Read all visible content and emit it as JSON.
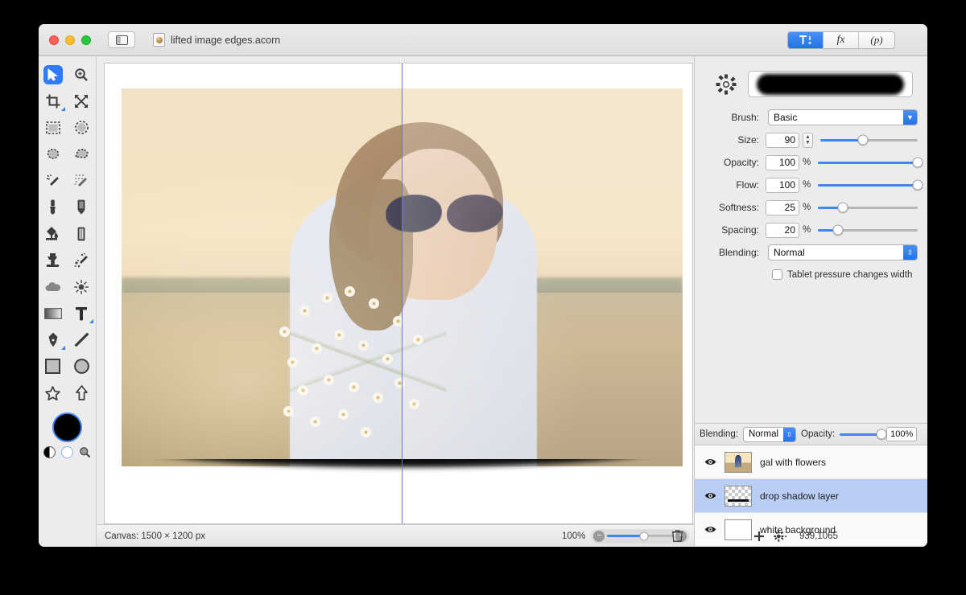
{
  "window": {
    "title": "lifted image edges.acorn",
    "traffic_lights": [
      "close",
      "minimize",
      "zoom"
    ],
    "sidebar_toggle": "sidebar-toggle"
  },
  "inspector_tabs": [
    {
      "id": "tool",
      "label": "",
      "icon": "tool-options-icon",
      "selected": true
    },
    {
      "id": "fx",
      "label": "fx",
      "icon": "effects-icon",
      "selected": false
    },
    {
      "id": "p",
      "label": "(p)",
      "icon": "presets-icon",
      "selected": false
    }
  ],
  "tools": [
    {
      "name": "move-tool",
      "icon": "arrow-cursor-icon",
      "selected": true
    },
    {
      "name": "zoom-tool",
      "icon": "magnifier-plus-icon",
      "selected": false
    },
    {
      "name": "crop-tool",
      "icon": "crop-icon",
      "selected": false,
      "badge": true
    },
    {
      "name": "transform-tool",
      "icon": "transform-arrows-icon",
      "selected": false
    },
    {
      "name": "rectangular-select-tool",
      "icon": "rect-marquee-icon",
      "selected": false
    },
    {
      "name": "elliptical-select-tool",
      "icon": "ellipse-marquee-icon",
      "selected": false
    },
    {
      "name": "lasso-tool",
      "icon": "lasso-icon",
      "selected": false
    },
    {
      "name": "polygon-lasso-tool",
      "icon": "polygon-lasso-icon",
      "selected": false
    },
    {
      "name": "magic-wand-tool",
      "icon": "magic-wand-icon",
      "selected": false
    },
    {
      "name": "instant-alpha-tool",
      "icon": "magic-wand-dotted-icon",
      "selected": false
    },
    {
      "name": "brush-tool",
      "icon": "paintbrush-icon",
      "selected": false
    },
    {
      "name": "pencil-tool",
      "icon": "pencil-icon",
      "selected": false
    },
    {
      "name": "paint-bucket-tool",
      "icon": "paint-bucket-icon",
      "selected": false
    },
    {
      "name": "eraser-tool",
      "icon": "eraser-icon",
      "selected": false
    },
    {
      "name": "clone-stamp-tool",
      "icon": "clone-stamp-icon",
      "selected": false
    },
    {
      "name": "smudge-tool",
      "icon": "smudge-icon",
      "selected": false
    },
    {
      "name": "blur-tool",
      "icon": "cloud-blur-icon",
      "selected": false
    },
    {
      "name": "dodge-tool",
      "icon": "dodge-sun-icon",
      "selected": false
    },
    {
      "name": "gradient-tool",
      "icon": "gradient-icon",
      "selected": false
    },
    {
      "name": "text-tool",
      "icon": "text-t-icon",
      "selected": false,
      "badge": true
    },
    {
      "name": "bezier-pen-tool",
      "icon": "pen-nib-icon",
      "selected": false,
      "badge": true
    },
    {
      "name": "line-tool",
      "icon": "line-icon",
      "selected": false
    },
    {
      "name": "rectangle-tool",
      "icon": "rectangle-shape-icon",
      "selected": false
    },
    {
      "name": "ellipse-tool",
      "icon": "ellipse-shape-icon",
      "selected": false
    },
    {
      "name": "star-tool",
      "icon": "star-shape-icon",
      "selected": false
    },
    {
      "name": "arrow-tool",
      "icon": "arrow-shape-icon",
      "selected": false
    }
  ],
  "colors": {
    "foreground": "#000000",
    "background": "#ffffff",
    "accent": "#2f7bf6",
    "selection_row": "#b9cdf5"
  },
  "brush_panel": {
    "preview_label": "brush-preview",
    "gear_label": "brush-settings-gear",
    "brush": {
      "label": "Brush:",
      "value": "Basic"
    },
    "size": {
      "label": "Size:",
      "value": "90",
      "unit": "",
      "fill_pct": 44
    },
    "opacity": {
      "label": "Opacity:",
      "value": "100",
      "unit": "%",
      "fill_pct": 100
    },
    "flow": {
      "label": "Flow:",
      "value": "100",
      "unit": "%",
      "fill_pct": 100
    },
    "softness": {
      "label": "Softness:",
      "value": "25",
      "unit": "%",
      "fill_pct": 25
    },
    "spacing": {
      "label": "Spacing:",
      "value": "20",
      "unit": "%",
      "fill_pct": 20
    },
    "blending": {
      "label": "Blending:",
      "value": "Normal"
    },
    "tablet_checkbox": {
      "label": "Tablet pressure changes width",
      "checked": false
    }
  },
  "layers_header": {
    "blending_label": "Blending:",
    "blending_value": "Normal",
    "opacity_label": "Opacity:",
    "opacity_value": "100%"
  },
  "layers": [
    {
      "name": "gal with flowers",
      "visible": true,
      "selected": false,
      "thumb": "photo"
    },
    {
      "name": "drop shadow layer",
      "visible": true,
      "selected": true,
      "thumb": "transparent-shadow"
    },
    {
      "name": "white background",
      "visible": true,
      "selected": false,
      "thumb": "white"
    }
  ],
  "statusbar": {
    "canvas_size": "Canvas: 1500 × 1200 px",
    "zoom_level": "100%",
    "zoom_out_icon": "minus-icon",
    "zoom_in_icon": "plus-icon",
    "add_layer_icon": "plus-icon",
    "layer_actions_icon": "gear-dropdown-icon",
    "coordinates": "939,1065",
    "delete_icon": "trash-icon"
  },
  "canvas": {
    "guide_label": "vertical-guide",
    "image_alt": "woman with sunglasses holding daisies in a sunlit field"
  }
}
